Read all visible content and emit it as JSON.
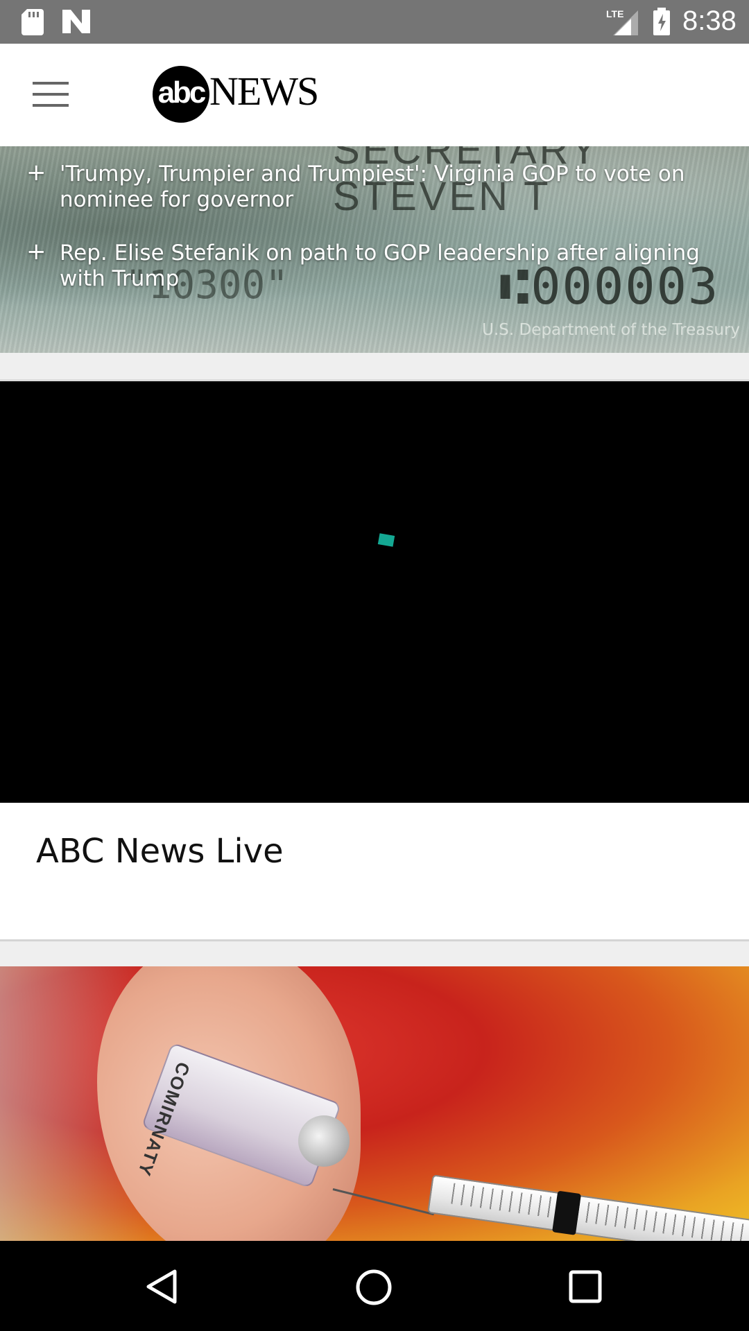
{
  "status_bar": {
    "time": "8:38",
    "network": "LTE",
    "icons": [
      "sd-card-icon",
      "n-icon",
      "lte-signal-icon",
      "battery-charging-icon"
    ]
  },
  "header": {
    "logo_abc": "abc",
    "logo_news": "NEWS",
    "menu_icon": "hamburger-menu-icon"
  },
  "hero": {
    "check_top_text": "SECRETARY STEVEN T",
    "check_left_text": "\"10300\"",
    "check_number_text": "⑆000003",
    "stories": [
      {
        "label": "'Trumpy, Trumpier and Trumpiest': Virginia GOP to vote on nominee for governor"
      },
      {
        "label": "Rep. Elise Stefanik on path to GOP leadership after aligning with Trump"
      }
    ],
    "photo_credit": "U.S. Department of the Treasury"
  },
  "video": {
    "title": "ABC News Live",
    "spinner_color": "#14a893"
  },
  "image_card": {
    "vial_label": "COMIRNATY"
  },
  "nav": {
    "icons": [
      "back-icon",
      "home-icon",
      "recents-icon"
    ]
  }
}
